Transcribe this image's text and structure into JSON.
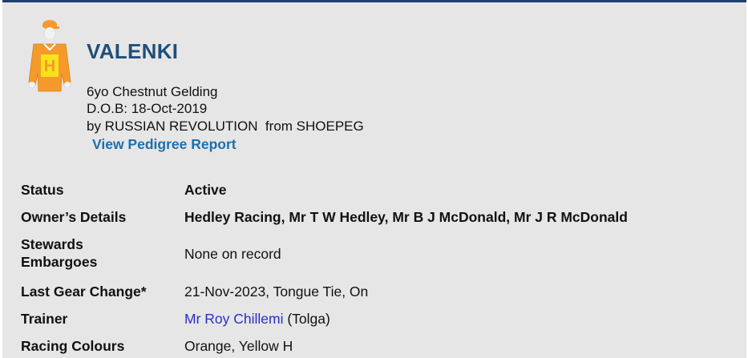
{
  "horse": {
    "name": "VALENKI",
    "age_sex": "6yo Chestnut Gelding",
    "dob": "D.O.B: 18-Oct-2019",
    "breeding": "by RUSSIAN REVOLUTION  from SHOEPEG",
    "pedigree_link": "View Pedigree Report",
    "silks_icon": "jockey-silks-icon",
    "silks_letter": "H"
  },
  "details": {
    "status_label": "Status",
    "status_value": "Active",
    "owner_label": "Owner’s Details",
    "owner_value": "Hedley Racing, Mr T W Hedley, Mr B J McDonald, Mr J R McDonald",
    "stewards_label_1": "Stewards",
    "stewards_label_2": "Embargoes",
    "stewards_value": "None on record",
    "gear_label": "Last Gear Change*",
    "gear_value": "21-Nov-2023, Tongue Tie, On",
    "trainer_label": "Trainer",
    "trainer_name": "Mr Roy Chillemi",
    "trainer_location": " (Tolga)",
    "colours_label": "Racing Colours",
    "colours_value": "Orange, Yellow H"
  },
  "colors": {
    "name": "#1f4e79",
    "link": "#1a6fae",
    "trainer_link": "#2a2fc4",
    "silks_orange": "#f59a2a",
    "silks_yellow": "#f7e21b"
  }
}
